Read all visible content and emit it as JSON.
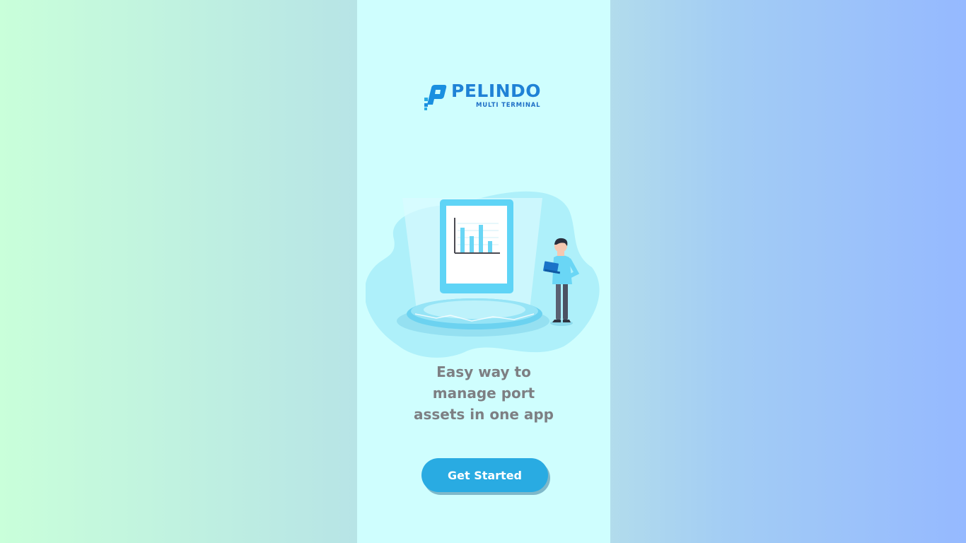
{
  "brand": {
    "name": "PELINDO",
    "subtitle": "MULTI TERMINAL",
    "logo_icon": "pelindo-logo-icon",
    "color": "#1f82d6"
  },
  "hero": {
    "illustration_icon": "dashboard-presentation-illustration"
  },
  "tagline": {
    "line1": "Easy way to",
    "line2": "manage port",
    "line3": "assets in one app"
  },
  "cta": {
    "label": "Get Started",
    "color": "#29abe2"
  },
  "background": {
    "gradient_left": "#c9ffda",
    "gradient_right": "#95b9ff",
    "panel": "#cffefe"
  }
}
